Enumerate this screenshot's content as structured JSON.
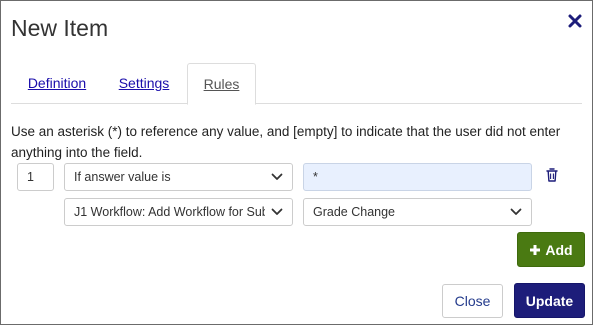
{
  "dialog": {
    "title": "New Item"
  },
  "tabs": [
    {
      "label": "Definition",
      "active": false
    },
    {
      "label": "Settings",
      "active": false
    },
    {
      "label": "Rules",
      "active": true
    }
  ],
  "rules": {
    "instructions": "Use an asterisk (*) to reference any value, and [empty] to indicate that the user did not enter anything into the field.",
    "row": {
      "order": "1",
      "condition_selected": "If answer value is",
      "answer_value": "*",
      "workflow_selected": "J1 Workflow: Add Workflow for Sub",
      "item_selected": "Grade Change"
    }
  },
  "buttons": {
    "add": "Add",
    "close": "Close",
    "update": "Update"
  },
  "colors": {
    "add_button": "#4a7a12",
    "update_button": "#1d1d7a",
    "close_icon": "#1d1d7a",
    "answer_field_bg": "#e8f0fe"
  },
  "icons": {
    "close": "close-icon",
    "trash": "trash-icon",
    "plus": "plus-icon",
    "dropdown": "chevron-down-icon"
  }
}
